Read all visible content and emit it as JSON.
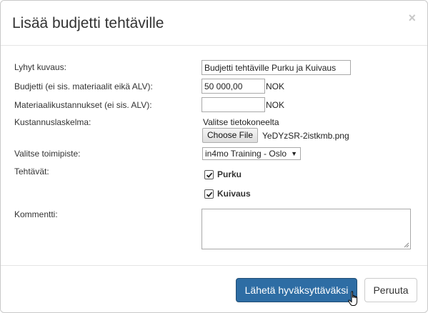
{
  "modal": {
    "title": "Lisää budjetti tehtäville",
    "close_glyph": "×"
  },
  "form": {
    "short_description": {
      "label": "Lyhyt kuvaus:",
      "value": "Budjetti tehtäville Purku ja Kuivaus"
    },
    "budget": {
      "label": "Budjetti (ei sis. materiaalit eikä ALV):",
      "value": "50 000,00",
      "currency": "NOK"
    },
    "material_costs": {
      "label": "Materiaalikustannukset (ei sis. ALV):",
      "value": "",
      "currency": "NOK"
    },
    "calculation": {
      "label": "Kustannuslaskelma:",
      "hint": "Valitse tietokoneelta",
      "button_label": "Choose File",
      "file_name": "YeDYzSR-2istkmb.png"
    },
    "office": {
      "label": "Valitse toimipiste:",
      "selected": "in4mo Training - Oslo",
      "arrow": "▼"
    },
    "tasks": {
      "label": "Tehtävät:",
      "items": [
        {
          "label": "Purku",
          "checked": true
        },
        {
          "label": "Kuivaus",
          "checked": true
        }
      ]
    },
    "comment": {
      "label": "Kommentti:",
      "value": ""
    }
  },
  "footer": {
    "submit_label": "Lähetä hyväksyttäväksi",
    "cancel_label": "Peruuta"
  },
  "colors": {
    "primary": "#2e6da4",
    "primary_border": "#204d74"
  },
  "icons": {
    "checkbox": "check-icon",
    "cursor": "hand-pointer-icon"
  }
}
